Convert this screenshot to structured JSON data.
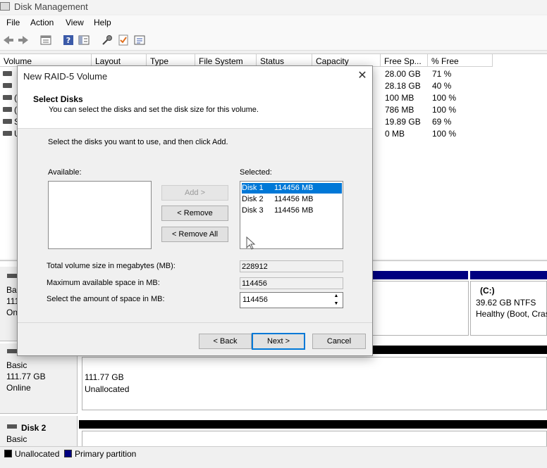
{
  "window": {
    "title": "Disk Management"
  },
  "menu": [
    "File",
    "Action",
    "View",
    "Help"
  ],
  "toolbar_icons": [
    "back-arrow-icon",
    "forward-arrow-icon",
    "properties-icon",
    "help-icon",
    "view-icon",
    "connect-icon",
    "check-icon",
    "list-icon"
  ],
  "volume_list": {
    "columns": [
      "Volume",
      "Layout",
      "Type",
      "File System",
      "Status",
      "Capacity",
      "Free Sp...",
      "% Free"
    ],
    "rows": [
      {
        "letter": "",
        "free": "28.00 GB",
        "pct": "71 %"
      },
      {
        "letter": "",
        "free": "28.18 GB",
        "pct": "40 %"
      },
      {
        "letter": "(",
        "free": "100 MB",
        "pct": "100 %"
      },
      {
        "letter": "(",
        "free": "786 MB",
        "pct": "100 %"
      },
      {
        "letter": "S",
        "free": "19.89 GB",
        "pct": "69 %"
      },
      {
        "letter": "U",
        "free": "0 MB",
        "pct": "100 %"
      }
    ]
  },
  "graph": {
    "disk0": {
      "l1": "Basi",
      "l2": "111",
      "l3": "Onl",
      "c_title": "(C:)",
      "c_size": "39.62 GB NTFS",
      "c_status": "Healthy (Boot, Cras"
    },
    "disk1": {
      "type": "Basic",
      "size": "111.77 GB",
      "status": "Online",
      "seg_size": "111.77 GB",
      "seg_label": "Unallocated"
    },
    "disk2": {
      "name": "Disk 2",
      "type": "Basic"
    }
  },
  "legend": {
    "unallocated": "Unallocated",
    "primary": "Primary partition",
    "unallocated_color": "#000000",
    "primary_color": "#000080"
  },
  "dialog": {
    "title": "New RAID-5 Volume",
    "heading": "Select Disks",
    "subheading": "You can select the disks and set the disk size for this volume.",
    "instruction": "Select the disks you want to use, and then click Add.",
    "available_label": "Available:",
    "selected_label": "Selected:",
    "add_button": "Add >",
    "remove_button": "< Remove",
    "remove_all_button": "< Remove All",
    "selected_disks": [
      {
        "disk": "Disk 1",
        "size": "114456 MB"
      },
      {
        "disk": "Disk 2",
        "size": "114456 MB"
      },
      {
        "disk": "Disk 3",
        "size": "114456 MB"
      }
    ],
    "total_label": "Total volume size in megabytes (MB):",
    "total_value": "228912",
    "max_label": "Maximum available space in MB:",
    "max_value": "114456",
    "amount_label": "Select the amount of space in MB:",
    "amount_value": "114456",
    "back_button": "< Back",
    "next_button": "Next >",
    "cancel_button": "Cancel",
    "accent_color": "#0078d7"
  }
}
